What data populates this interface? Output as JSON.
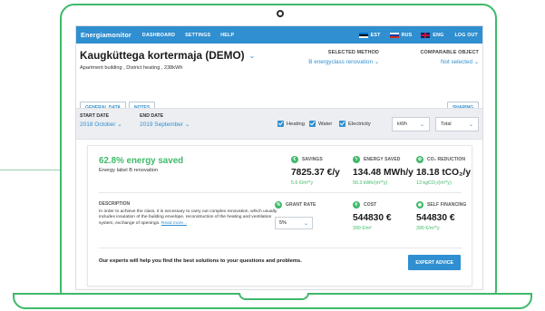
{
  "app": {
    "brand": "Energiamonitor",
    "nav": [
      "DASHBOARD",
      "SETTINGS",
      "HELP"
    ],
    "languages": [
      {
        "code": "EST",
        "flag": "estonia-flag"
      },
      {
        "code": "RUS",
        "flag": "russia-flag"
      },
      {
        "code": "ENG",
        "flag": "uk-flag"
      }
    ],
    "logout": "LOG OUT",
    "accent_color": "#2f8fd0",
    "green_color": "#3fb96a"
  },
  "building": {
    "title": "Kaugküttega kortermaja (DEMO)",
    "subtitle": "Apartment building , District heating , 238kWh"
  },
  "method": {
    "label": "SELECTED METHOD",
    "value": "B energyclass renovation"
  },
  "compare": {
    "label": "COMPARABLE OBJECT",
    "value": "Not selected"
  },
  "buttons": {
    "general": "GENERAL DATA",
    "notes": "NOTES",
    "sharing": "SHARING"
  },
  "filters": {
    "start_label": "START DATE",
    "start_value": "2018 October",
    "end_label": "END DATE",
    "end_value": "2019 September",
    "checks": [
      "Heating",
      "Water",
      "Electricity"
    ],
    "unit": "kWh",
    "aggregate": "Total"
  },
  "result": {
    "saved_title": "62.8% energy saved",
    "saved_sub": "Energy label B renovation",
    "metrics": [
      {
        "label": "SAVINGS",
        "value": "7825.37 €/y",
        "sub": "5.6 €/m²*y",
        "icon": "euro-icon"
      },
      {
        "label": "ENERGY SAVED",
        "value": "134.48 MWh/y",
        "sub": "56.3 kWh/(m²*y)",
        "icon": "bolt-icon"
      },
      {
        "label": "CO₂ REDUCTION",
        "value": "18.18 tCO₂/y",
        "sub": "13 kgCO₂/(m²*y)",
        "icon": "leaf-icon"
      }
    ],
    "description_label": "DESCRIPTION",
    "description": "In order to achieve the class, it is necessary to carry out complex renovation, which usually includes insulation of the building envelope, reconstruction of the heating and ventilation system, exchange of openings.",
    "read_more": "Read more...",
    "grant_label": "GRANT RATE",
    "grant_value": "5%",
    "cost_label": "COST",
    "cost_value": "544830 €",
    "cost_sub": "390 €/m²",
    "self_label": "SELF FINANCING",
    "self_value": "544830 €",
    "self_sub": "390 €/m²*y",
    "experts_text": "Our experts will help you find the best solutions to your questions and problems.",
    "expert_button": "EXPERT ADVICE"
  }
}
